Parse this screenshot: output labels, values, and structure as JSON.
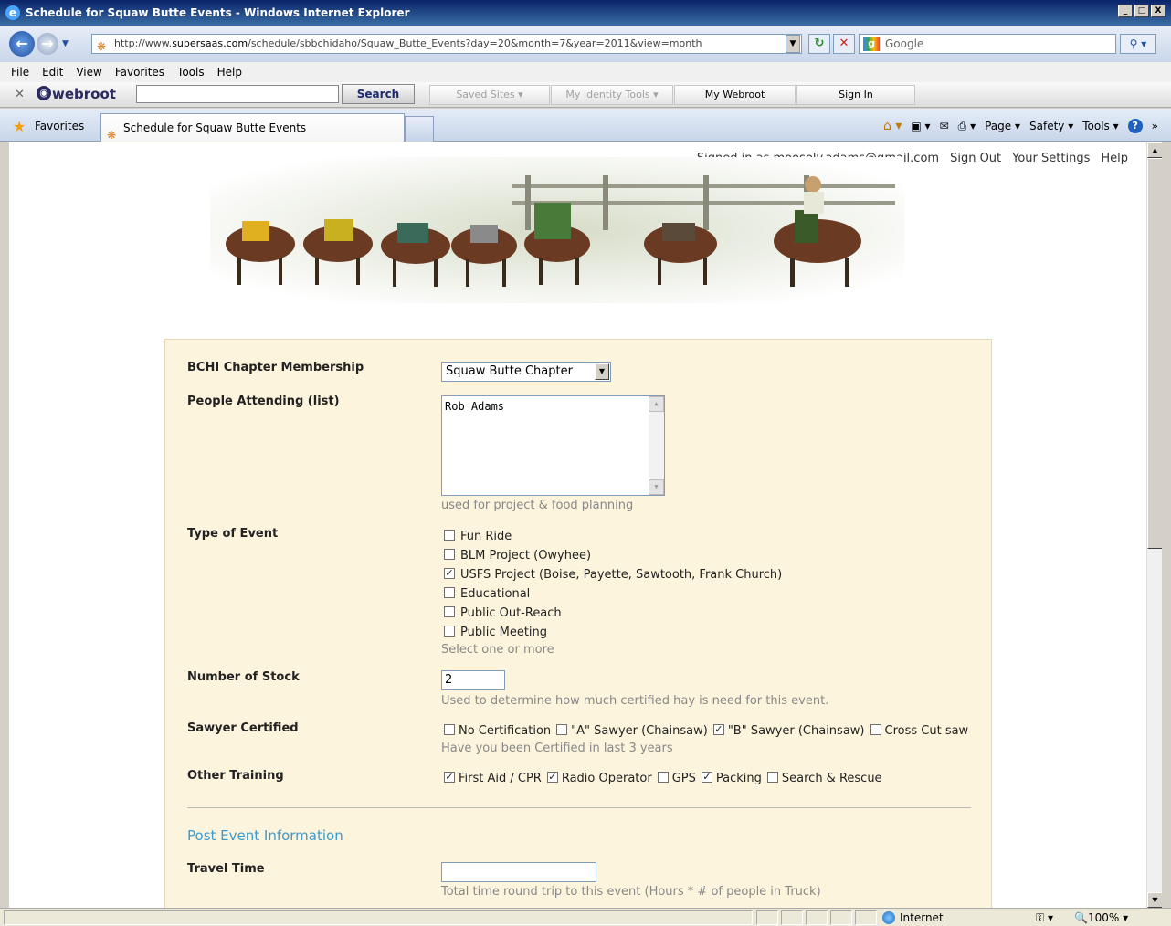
{
  "window": {
    "title": "Schedule for Squaw Butte Events - Windows Internet Explorer",
    "min": "_",
    "max": "□",
    "close": "X"
  },
  "addressbar": {
    "url_prefix": "http://www.",
    "url_domain": "supersaas.com",
    "url_path": "/schedule/sbbchidaho/Squaw_Butte_Events?day=20&month=7&year=2011&view=month",
    "search_provider": "Google"
  },
  "menu": [
    "File",
    "Edit",
    "View",
    "Favorites",
    "Tools",
    "Help"
  ],
  "webroot": {
    "logo": "webroot",
    "search_label": "Search",
    "tabs": [
      "Saved Sites",
      "My Identity Tools",
      "My Webroot",
      "Sign In"
    ]
  },
  "favorites": {
    "label": "Favorites",
    "tab_title": "Schedule for Squaw Butte Events",
    "commands": [
      "Page",
      "Safety",
      "Tools"
    ]
  },
  "toplinks": {
    "signed_in": "Signed in as moosely.adams@gmail.com",
    "sign_out": "Sign Out",
    "settings": "Your Settings",
    "help": "Help"
  },
  "form": {
    "membership": {
      "label": "BCHI Chapter Membership",
      "value": "Squaw Butte Chapter"
    },
    "people": {
      "label": "People Attending (list)",
      "value": "Rob Adams",
      "hint": "used for project & food planning"
    },
    "event_type": {
      "label": "Type of Event",
      "options": [
        {
          "label": "Fun Ride",
          "checked": false
        },
        {
          "label": "BLM Project (Owyhee)",
          "checked": false
        },
        {
          "label": "USFS Project (Boise, Payette, Sawtooth, Frank Church)",
          "checked": true
        },
        {
          "label": "Educational",
          "checked": false
        },
        {
          "label": "Public Out-Reach",
          "checked": false
        },
        {
          "label": "Public Meeting",
          "checked": false
        }
      ],
      "hint": "Select one or more"
    },
    "stock": {
      "label": "Number of Stock",
      "value": "2",
      "hint": "Used to determine how much certified hay is need for this event."
    },
    "sawyer": {
      "label": "Sawyer Certified",
      "options": [
        {
          "label": "No Certification",
          "checked": false
        },
        {
          "label": "\"A\" Sawyer (Chainsaw)",
          "checked": false
        },
        {
          "label": "\"B\" Sawyer (Chainsaw)",
          "checked": true
        },
        {
          "label": "Cross Cut saw",
          "checked": false
        }
      ],
      "hint": "Have you been Certified in last 3 years"
    },
    "training": {
      "label": "Other Training",
      "options": [
        {
          "label": "First Aid / CPR",
          "checked": true
        },
        {
          "label": "Radio Operator",
          "checked": true
        },
        {
          "label": "GPS",
          "checked": false
        },
        {
          "label": "Packing",
          "checked": true
        },
        {
          "label": "Search & Rescue",
          "checked": false
        }
      ]
    },
    "post_section": "Post Event Information",
    "travel": {
      "label": "Travel Time",
      "value": "",
      "hint": "Total time round trip to this event (Hours * # of people in Truck)"
    }
  },
  "status": {
    "zone": "Internet",
    "zoom": "100%"
  }
}
